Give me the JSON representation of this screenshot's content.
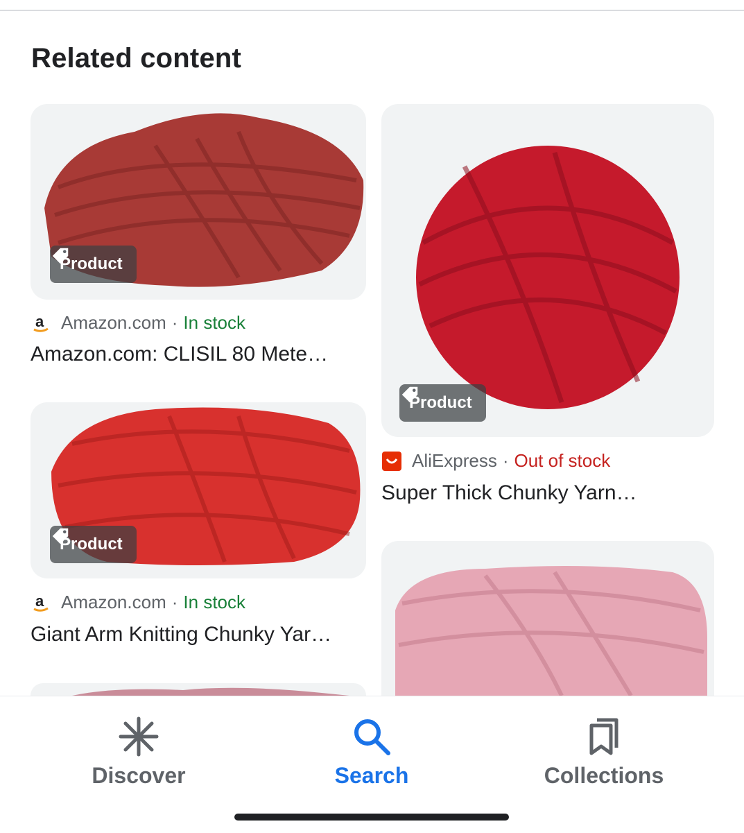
{
  "section": {
    "title": "Related content"
  },
  "chip_label": "Product",
  "results": [
    {
      "source": "Amazon.com",
      "stock": "In stock",
      "title": "Amazon.com: CLISIL 80 Mete…",
      "yarn_color": "#a83a36"
    },
    {
      "source": "AliExpress",
      "stock": "Out of stock",
      "title": "Super Thick Chunky Yarn…",
      "yarn_color": "#c51a2c"
    },
    {
      "source": "Amazon.com",
      "stock": "In stock",
      "title": "Giant Arm Knitting Chunky Yar…",
      "yarn_color": "#d8312e"
    },
    {
      "yarn_color": "#e6a7b5"
    },
    {
      "yarn_color": "#c98c99"
    }
  ],
  "separator": "·",
  "nav": {
    "discover": "Discover",
    "search": "Search",
    "collections": "Collections"
  },
  "colors": {
    "accent": "#1a73e8",
    "in_stock": "#188038",
    "out_of_stock": "#c5221f"
  }
}
